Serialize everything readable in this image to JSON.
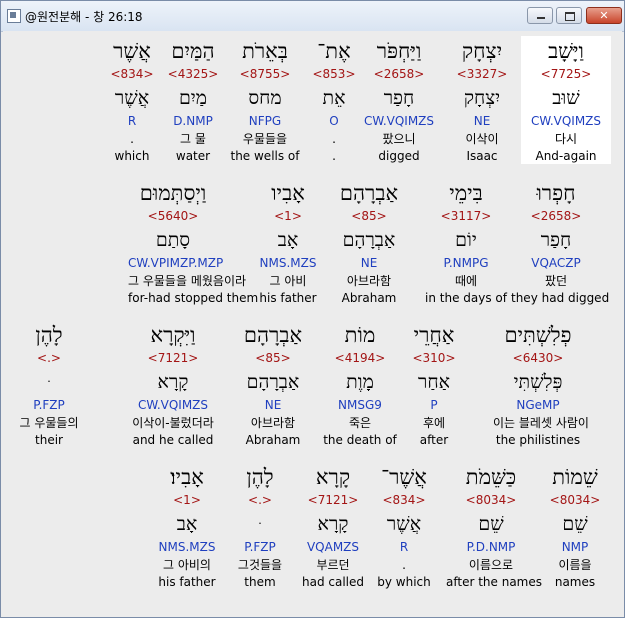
{
  "window": {
    "title": "@원전분해 - 창 26:18"
  },
  "rows": [
    [
      {
        "heb": "וַיָּשָׁב",
        "strong": "<7725>",
        "lemma": "שׁוּב",
        "parse": "CW.VQIMZS",
        "kor": "다시",
        "eng": "And-again",
        "highlight": true
      },
      {
        "heb": "יִצְחָק",
        "strong": "<3327>",
        "lemma": "יִצְחָק",
        "parse": "NE",
        "kor": "이삭이",
        "eng": "Isaac"
      },
      {
        "heb": "וַיַּחְפֹּר",
        "strong": "<2658>",
        "lemma": "חָפַר",
        "parse": "CW.VQIMZS",
        "kor": "팠으니",
        "eng": "digged"
      },
      {
        "heb": "אֶת־",
        "strong": "<853>",
        "lemma": "אֵת",
        "parse": "O",
        "kor": ".",
        "eng": "."
      },
      {
        "heb": "בְּאֵרֹת",
        "strong": "<8755>",
        "lemma": "מחס",
        "parse": "NFPG",
        "kor": "우물들을",
        "eng": "the wells of"
      },
      {
        "heb": "הַמַּיִם",
        "strong": "<4325>",
        "lemma": "מַיִם",
        "parse": "D.NMP",
        "kor": "그 물",
        "eng": "water"
      },
      {
        "heb": "אֲשֶׁר",
        "strong": "<834>",
        "lemma": "אֲשֶׁר",
        "parse": "R",
        "kor": ".",
        "eng": "which"
      }
    ],
    [
      {
        "heb": "חָפְרוּ",
        "strong": "<2658>",
        "lemma": "חָפַר",
        "parse": "VQACZP",
        "kor": "팠던",
        "eng": "they had digged"
      },
      {
        "heb": "בִּימֵי",
        "strong": "<3117>",
        "lemma": "יוֹם",
        "parse": "P.NMPG",
        "kor": "때에",
        "eng": "in the days of"
      },
      {
        "heb": "אַבְרָהָם",
        "strong": "<85>",
        "lemma": "אַבְרָהָם",
        "parse": "NE",
        "kor": "아브라함",
        "eng": "Abraham"
      },
      {
        "heb": "אָבִיו",
        "strong": "<1>",
        "lemma": "אָב",
        "parse": "NMS.MZS",
        "kor": "그 아비",
        "eng": "his father"
      },
      {
        "heb": "וַיְסַתְּמוּם",
        "strong": "<5640>",
        "lemma": "סָתַם",
        "parse": "CW.VPIMZP.MZP",
        "kor": "그 우물들을 메웠음이라",
        "eng": "for-had stopped them"
      }
    ],
    [
      {
        "heb": "פְלִשְׁתִּים",
        "strong": "<6430>",
        "lemma": "פְּלִשְׁתִּי",
        "parse": "NGeMP",
        "kor": "이는 블레셋 사람이",
        "eng": "the philistines"
      },
      {
        "heb": "אַחֲרֵי",
        "strong": "<310>",
        "lemma": "אַחַר",
        "parse": "P",
        "kor": "후에",
        "eng": "after"
      },
      {
        "heb": "מוֹת",
        "strong": "<4194>",
        "lemma": "מָוֶת",
        "parse": "NMSG9",
        "kor": "죽은",
        "eng": "the death of"
      },
      {
        "heb": "אַבְרָהָם",
        "strong": "<85>",
        "lemma": "אַבְרָהָם",
        "parse": "NE",
        "kor": "아브라함",
        "eng": "Abraham"
      },
      {
        "heb": "וַיִּקְרָא",
        "strong": "<7121>",
        "lemma": "קָרָא",
        "parse": "CW.VQIMZS",
        "kor": "이삭이-불렀더라",
        "eng": "and he called"
      },
      {
        "heb": "לָהֶן",
        "strong": "<.>",
        "lemma": "ּ",
        "parse": "P.FZP",
        "kor": "그 우물들의",
        "eng": "their"
      }
    ],
    [
      {
        "heb": "שֵׁמוֹת",
        "strong": "<8034>",
        "lemma": "שֵׁם",
        "parse": "NMP",
        "kor": "이름을",
        "eng": "names"
      },
      {
        "heb": "כַּשֵּׁמֹת",
        "strong": "<8034>",
        "lemma": "שֵׁם",
        "parse": "P.D.NMP",
        "kor": "이름으로",
        "eng": "after the names"
      },
      {
        "heb": "אֲשֶׁר־",
        "strong": "<834>",
        "lemma": "אֲשֶׁר",
        "parse": "R",
        "kor": ".",
        "eng": "by which"
      },
      {
        "heb": "קָרָא",
        "strong": "<7121>",
        "lemma": "קָרָא",
        "parse": "VQAMZS",
        "kor": "부르던",
        "eng": "had called"
      },
      {
        "heb": "לָהֶן",
        "strong": "<.>",
        "lemma": "ּ",
        "parse": "P.FZP",
        "kor": "그것들을",
        "eng": "them"
      },
      {
        "heb": "אָבִיו׃",
        "strong": "<1>",
        "lemma": "אָב",
        "parse": "NMS.MZS",
        "kor": "그 아비의",
        "eng": "his father"
      }
    ]
  ]
}
